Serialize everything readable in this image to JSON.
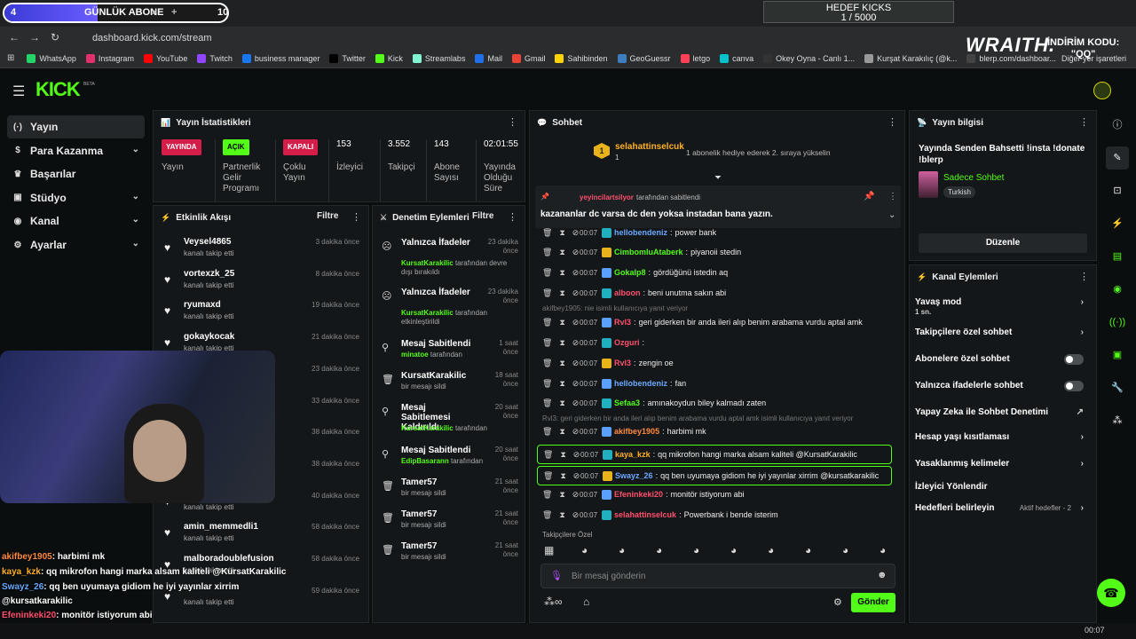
{
  "top_goal": {
    "count": "4",
    "label": "GÜNLÜK ABONE",
    "target": "10",
    "fill_pct": 0.42,
    "close": "×",
    "plus": "+"
  },
  "hedef": {
    "title": "HEDEF KICKS",
    "progress": "1 / 5000"
  },
  "browser": {
    "url": "dashboard.kick.com/stream",
    "bookmarks": [
      "WhatsApp",
      "Instagram",
      "YouTube",
      "Twitch",
      "business manager",
      "Twitter",
      "Kick",
      "Streamlabs",
      "Mail",
      "Gmail",
      "Sahibinden",
      "GeoGuessr",
      "letgo",
      "canva",
      "Okey Oyna - Canlı 1...",
      "Kurşat Karakılıç (@k...",
      "blerp.com/dashboar..."
    ],
    "other_bookmarks": "Diğer yer işaretleri"
  },
  "sponsor": {
    "brand": "WRAITH.",
    "line1": "İNDİRİM KODU:",
    "line2": "\"QQ\""
  },
  "app": {
    "logo": "KICK",
    "beta": "BETA"
  },
  "nav": [
    {
      "label": "Yayın",
      "icon": "(·)"
    },
    {
      "label": "Para Kazanma",
      "icon": "$"
    },
    {
      "label": "Başarılar",
      "icon": "♛"
    },
    {
      "label": "Stüdyo",
      "icon": "▣"
    },
    {
      "label": "Kanal",
      "icon": "◉"
    },
    {
      "label": "Ayarlar",
      "icon": "⚙"
    }
  ],
  "stats": {
    "title": "Yayın İstatistikleri",
    "items": [
      {
        "tag": "YAYINDA",
        "label": "Yayın"
      },
      {
        "tag": "AÇIK",
        "label": "Partnerlik Gelir Programı"
      },
      {
        "tag": "KAPALI",
        "label": "Çoklu Yayın"
      },
      {
        "value": "153",
        "label": "İzleyici"
      },
      {
        "value": "3.552",
        "label": "Takipçi"
      },
      {
        "value": "143",
        "label": "Abone Sayısı"
      },
      {
        "value": "02:01:55",
        "label": "Yayında Olduğu Süre"
      }
    ]
  },
  "activity": {
    "title": "Etkinlik Akışı",
    "filter": "Filtre",
    "items": [
      {
        "name": "Veysel4865",
        "sub": "kanalı takip etti",
        "time": "3 dakika önce"
      },
      {
        "name": "vortexzk_25",
        "sub": "kanalı takip etti",
        "time": "8 dakika önce"
      },
      {
        "name": "ryumaxd",
        "sub": "kanalı takip etti",
        "time": "19 dakika önce"
      },
      {
        "name": "gokaykocak",
        "sub": "kanalı takip etti",
        "time": "21 dakika önce"
      },
      {
        "name": "",
        "sub": "",
        "time": "23 dakika önce"
      },
      {
        "name": "",
        "sub": "",
        "time": "33 dakika önce"
      },
      {
        "name": "",
        "sub": "",
        "time": "38 dakika önce"
      },
      {
        "name": "",
        "sub": "",
        "time": "38 dakika önce"
      },
      {
        "name": "",
        "sub": "kanalı takip etti",
        "time": "40 dakika önce"
      },
      {
        "name": "amin_memmedli1",
        "sub": "kanalı takip etti",
        "time": "58 dakika önce"
      },
      {
        "name": "malboradoublefusion",
        "sub": "kanalı takip etti",
        "time": "58 dakika önce"
      },
      {
        "name": "",
        "sub": "kanalı takip etti",
        "time": "59 dakika önce"
      }
    ]
  },
  "mod": {
    "title": "Denetim Eylemleri",
    "filter": "Filtre",
    "items": [
      {
        "icon": "☹",
        "name": "Yalnızca İfadeler",
        "user": "KursatKarakilic",
        "sub": "tarafından devre dışı bırakıldı",
        "time": "23 dakika önce"
      },
      {
        "icon": "☹",
        "name": "Yalnızca İfadeler",
        "user": "KursatKarakilic",
        "sub": "tarafından etkinleştirildi",
        "time": "23 dakika önce"
      },
      {
        "icon": "⚲",
        "name": "Mesaj Sabitlendi",
        "user": "minatoe",
        "sub": "tarafından",
        "time": "1 saat önce"
      },
      {
        "icon": "🗑",
        "name": "KursatKarakilic",
        "user": "",
        "sub": "bir mesajı sildi",
        "time": "18 saat önce"
      },
      {
        "icon": "⚲",
        "name": "Mesaj Sabitlemesi Kaldırıldı",
        "user": "KursatKarakilic",
        "sub": "tarafından",
        "time": "20 saat önce"
      },
      {
        "icon": "⚲",
        "name": "Mesaj Sabitlendi",
        "user": "EdipBasarann",
        "sub": "tarafından",
        "time": "20 saat önce"
      },
      {
        "icon": "🗑",
        "name": "Tamer57",
        "user": "",
        "sub": "bir mesajı sildi",
        "time": "21 saat önce"
      },
      {
        "icon": "🗑",
        "name": "Tamer57",
        "user": "",
        "sub": "bir mesajı sildi",
        "time": "21 saat önce"
      },
      {
        "icon": "🗑",
        "name": "Tamer57",
        "user": "",
        "sub": "bir mesajı sildi",
        "time": "21 saat önce"
      }
    ]
  },
  "chat": {
    "title": "Sohbet",
    "gift": {
      "user": "selahattinselcuk",
      "count": "1",
      "text": "1 abonelik hediye ederek 2. sıraya yükselin"
    },
    "pinned": {
      "by": "yeyincilartsilyor",
      "by_suffix": "tarafından sabitlendi",
      "text": "kazananlar dc varsa dc den yoksa instadan bana yazın."
    },
    "messages": [
      {
        "time": "00:07",
        "user": "hellobendeniz",
        "color": "#6aa8ff",
        "text": "power bank"
      },
      {
        "time": "00:07",
        "user": "CimbomluAtaberk",
        "color": "#53fc18",
        "text": "piyanoii stedin"
      },
      {
        "time": "00:07",
        "user": "Gokalp8",
        "color": "#53fc18",
        "text": "gördüğünü istedin aq"
      },
      {
        "time": "00:07",
        "user": "alboon",
        "color": "#ff4f6d",
        "text": "beni unutma sakın abi"
      },
      {
        "reply": "akifbey1905: nie isimli kullanıcıya yanıt veriyor"
      },
      {
        "time": "00:07",
        "user": "Rvl3",
        "color": "#ff4f6d",
        "text": "geri giderken bir anda ileri alıp benim arabama vurdu aptal amk"
      },
      {
        "time": "00:07",
        "user": "Ozguri",
        "color": "#ff4f6d",
        "text": ""
      },
      {
        "time": "00:07",
        "user": "Rvl3",
        "color": "#ff4f6d",
        "text": "zengin oe"
      },
      {
        "time": "00:07",
        "user": "hellobendeniz",
        "color": "#6aa8ff",
        "text": "fan"
      },
      {
        "time": "00:07",
        "user": "Sefaa3",
        "color": "#53fc18",
        "text": "amınakoydun biley kalmadı zaten"
      },
      {
        "reply": "Rvl3: geri giderken bir anda ileri alıp benim arabama vurdu aptal amk isimli kullanıcıya yanıt veriyor"
      },
      {
        "time": "00:07",
        "user": "akifbey1905",
        "color": "#ff8a3d",
        "text": "harbimi mk"
      },
      {
        "time": "00:07",
        "user": "kaya_kzk",
        "color": "#ffb020",
        "text": "qq mikrofon hangi marka alsam kaliteli @KursatKarakilic",
        "hl": true
      },
      {
        "time": "00:07",
        "user": "Swayz_26",
        "color": "#6aa8ff",
        "text": "qq ben uyumaya gidiom he iyi yayınlar xirrim @kursatkarakilic",
        "hl": true
      },
      {
        "time": "00:07",
        "user": "Efeninkeki20",
        "color": "#ff4f6d",
        "text": "monitör istiyorum abi"
      },
      {
        "time": "00:07",
        "user": "selahattinselcuk",
        "color": "#ff4f6d",
        "text": "Powerbank i bende isterim"
      }
    ],
    "emote_label": "Takipçilere Özel",
    "input_placeholder": "Bir mesaj gönderin",
    "send": "Gönder"
  },
  "info": {
    "title": "Yayın bilgisi",
    "stream_title": "Yayında Senden Bahsetti !insta !donate !blerp",
    "category": "Sadece Sohbet",
    "language": "Turkish",
    "edit": "Düzenle"
  },
  "channel": {
    "title": "Kanal Eylemleri",
    "items": [
      {
        "label": "Yavaş mod",
        "sub": "1 sn.",
        "type": "arrow"
      },
      {
        "label": "Takipçilere özel sohbet",
        "type": "arrow"
      },
      {
        "label": "Abonelere özel sohbet",
        "type": "toggle"
      },
      {
        "label": "Yalnızca ifadelerle sohbet",
        "type": "toggle"
      },
      {
        "label": "Yapay Zeka ile Sohbet Denetimi",
        "type": "ext"
      },
      {
        "label": "Hesap yaşı kısıtlaması",
        "type": "arrow"
      },
      {
        "label": "Yasaklanmış kelimeler",
        "type": "arrow"
      },
      {
        "label": "İzleyici Yönlendir",
        "type": "none"
      },
      {
        "label": "Hedefleri belirleyin",
        "type": "arrow",
        "badge": "Aktif hedefler - 2"
      }
    ]
  },
  "overlay": [
    {
      "user": "akifbey1905",
      "text": ": harbimi mk",
      "color": "#ff8a3d"
    },
    {
      "user": "kaya_kzk",
      "text": ": qq mikrofon hangi marka alsam kaliteli @KursatKarakilic",
      "color": "#ffb020"
    },
    {
      "user": "Swayz_26",
      "text": ": qq ben uyumaya gidiom he iyi yayınlar xirrim",
      "color": "#6aa8ff"
    },
    {
      "user": "",
      "text": "@kursatkarakilic",
      "color": "#fff"
    },
    {
      "user": "Efeninkeki20",
      "text": ": monitör istiyorum abi",
      "color": "#ff4f6d"
    },
    {
      "user": "",
      "text": "Powerbank i bende isterim",
      "color": "#fff"
    }
  ],
  "clock": "00:07"
}
